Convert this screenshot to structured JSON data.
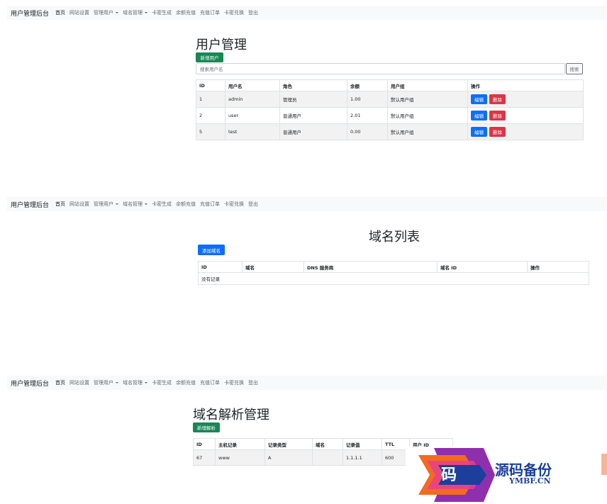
{
  "nav": {
    "brand": "用户管理后台",
    "items": [
      "首页",
      "网站设置",
      "管理用户",
      "域名管理",
      "卡密生成",
      "余额充值",
      "充值订单",
      "卡密兑换",
      "登出"
    ]
  },
  "users_page": {
    "title": "用户管理",
    "add_button": "新增用户",
    "search_placeholder": "搜索用户名",
    "search_button": "搜索",
    "columns": [
      "ID",
      "用户名",
      "角色",
      "余额",
      "用户组",
      "操作"
    ],
    "rows": [
      {
        "id": "1",
        "username": "admin",
        "role": "管理员",
        "balance": "1.00",
        "group": "默认用户组"
      },
      {
        "id": "2",
        "username": "user",
        "role": "普通用户",
        "balance": "2.01",
        "group": "默认用户组"
      },
      {
        "id": "5",
        "username": "test",
        "role": "普通用户",
        "balance": "0.00",
        "group": "默认用户组"
      }
    ],
    "edit_label": "编辑",
    "delete_label": "删除"
  },
  "domains_page": {
    "title": "域名列表",
    "add_button": "添加域名",
    "columns": [
      "ID",
      "域名",
      "DNS 服务商",
      "域名 ID",
      "操作"
    ],
    "empty_text": "没有记录"
  },
  "records_page": {
    "title": "域名解析管理",
    "add_button": "新增解析",
    "columns": [
      "ID",
      "主机记录",
      "记录类型",
      "域名",
      "记录值",
      "TTL",
      "用户 ID",
      "操作"
    ],
    "rows": [
      {
        "id": "67",
        "host": "www",
        "type": "A",
        "domain": "",
        "value": "1.1.1.1",
        "ttl": "600",
        "user_id": "",
        "action": ""
      }
    ]
  },
  "watermark": {
    "glyph": "码",
    "text": "源码备份",
    "url": "YMBF.CN",
    "colors": {
      "blue": "#1b3f9b",
      "orange": "#f26b21",
      "purple": "#8e2fae",
      "pink": "#e83e8c"
    }
  },
  "colors": {
    "success": "#198754",
    "primary": "#0d6efd",
    "danger": "#dc3545",
    "navbar": "#f8f9fa"
  }
}
